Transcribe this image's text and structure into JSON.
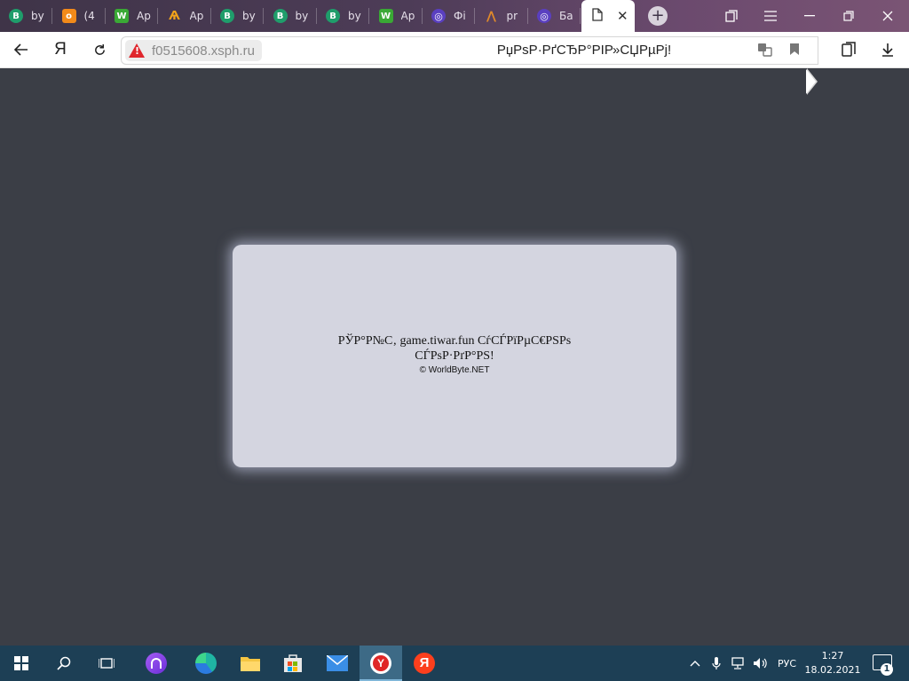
{
  "tabs": [
    {
      "label": "by",
      "icon": "b-badge-icon",
      "glyph": "B",
      "color": "#1f9d6b"
    },
    {
      "label": "(4",
      "icon": "odnoklassniki-icon",
      "glyph": "о",
      "color": "#f28a1a"
    },
    {
      "label": "Ар",
      "icon": "w-square-icon",
      "glyph": "W",
      "color": "#3aa935"
    },
    {
      "label": "Ар",
      "icon": "spark-icon",
      "glyph": "Ѧ",
      "color": "#f2a31a"
    },
    {
      "label": "by",
      "icon": "b-badge-icon",
      "glyph": "B",
      "color": "#1f9d6b"
    },
    {
      "label": "by",
      "icon": "b-badge-icon",
      "glyph": "B",
      "color": "#1f9d6b"
    },
    {
      "label": "by",
      "icon": "b-badge-icon",
      "glyph": "B",
      "color": "#1f9d6b"
    },
    {
      "label": "Ар",
      "icon": "w-square-icon",
      "glyph": "W",
      "color": "#3aa935"
    },
    {
      "label": "Фі",
      "icon": "spiral-icon",
      "glyph": "◎",
      "color": "#5a3fc0"
    },
    {
      "label": "pr",
      "icon": "wifi-tower-icon",
      "glyph": "⋀",
      "color": "#e08a2a"
    },
    {
      "label": "Ба",
      "icon": "spiral-icon",
      "glyph": "◎",
      "color": "#5a3fc0"
    }
  ],
  "active_tab": {
    "icon": "document-icon",
    "close": "✕"
  },
  "address": {
    "domain": "f0515608.xsph.ru",
    "page_title": "РџРѕР·РґСЂР°РІР»СЏРµРј!"
  },
  "content": {
    "message_line1": "РЎР°Р№С‚ game.tiwar.fun СѓСЃРїРµС€РЅРѕ",
    "message_line2": "СЃРѕР·РґР°РЅ!",
    "copyright": "© WorldByte.NET"
  },
  "taskbar": {
    "language": "РУС",
    "time": "1:27",
    "date": "18.02.2021",
    "notifications": "1"
  }
}
